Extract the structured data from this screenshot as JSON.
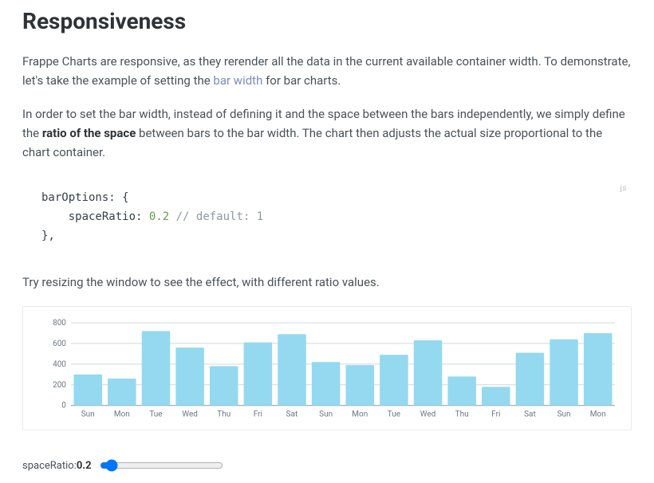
{
  "heading": "Responsiveness",
  "para1_a": "Frappe Charts are responsive, as they rerender all the data in the current available container width. To demonstrate, let's take the example of setting the ",
  "para1_link": "bar width",
  "para1_b": " for bar charts.",
  "para2_a": "In order to set the bar width, instead of defining it and the space between the bars independently, we simply define the ",
  "para2_strong": "ratio of the space",
  "para2_b": " between bars to the bar width. The chart then adjusts the actual size proportional to the chart container.",
  "code_lang": "js",
  "code_line1": "barOptions: {",
  "code_line2a": "spaceRatio: ",
  "code_line2b": "0.2",
  "code_line2c": " // default: 1",
  "code_line3": "},",
  "para3": "Try resizing the window to see the effect, with different ratio values.",
  "slider_label": "spaceRatio: ",
  "slider_value": "0.2",
  "chart_data": {
    "type": "bar",
    "categories": [
      "Sun",
      "Mon",
      "Tue",
      "Wed",
      "Thu",
      "Fri",
      "Sat",
      "Sun",
      "Mon",
      "Tue",
      "Wed",
      "Thu",
      "Fri",
      "Sat",
      "Sun",
      "Mon"
    ],
    "values": [
      300,
      260,
      720,
      560,
      380,
      610,
      690,
      420,
      390,
      490,
      630,
      280,
      180,
      510,
      640,
      700
    ],
    "yticks": [
      0,
      200,
      400,
      600,
      800
    ],
    "ylim": [
      0,
      800
    ],
    "title": "",
    "xlabel": "",
    "ylabel": ""
  }
}
